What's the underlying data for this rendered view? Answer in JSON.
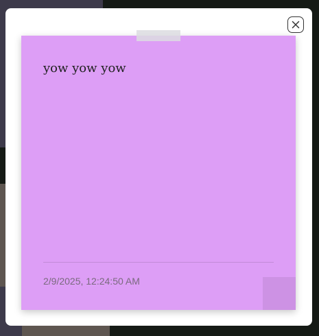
{
  "modal": {
    "close_icon": "close-x-icon"
  },
  "note": {
    "color": "#dd9ef6",
    "text": "yow yow yow",
    "timestamp": "2/9/2025, 12:24:50 AM"
  }
}
